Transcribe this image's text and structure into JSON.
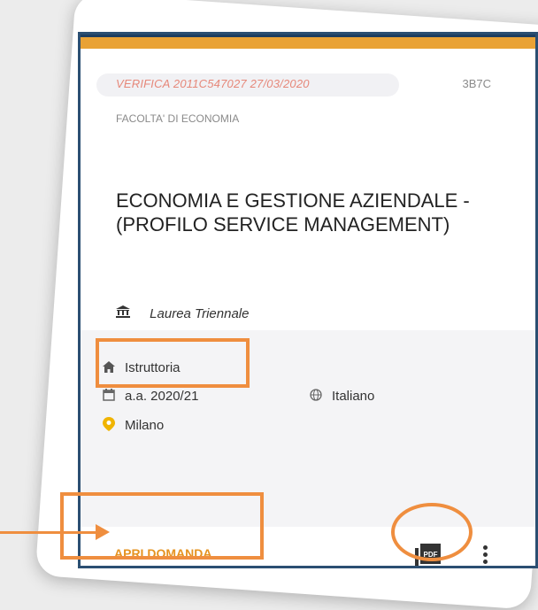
{
  "card": {
    "verifica": "VERIFICA  2011C547027  27/03/2020",
    "code": "3B7C",
    "faculty": "FACOLTA' DI ECONOMIA",
    "title": "ECONOMIA E GESTIONE AZIENDALE - (PROFILO SERVICE MANAGEMENT)",
    "degree_type": "Laurea  Triennale",
    "status": "Istruttoria",
    "academic_year": "a.a.  2020/21",
    "language": "Italiano",
    "location": "Milano",
    "open_button": "APRI DOMANDA",
    "pdf_label": "PDF"
  },
  "icons": {
    "degree": "institution-icon",
    "status": "home-icon",
    "year": "calendar-icon",
    "language": "globe-icon",
    "location": "location-pin-icon",
    "pdf": "pdf-icon",
    "more": "more-vert-icon"
  },
  "colors": {
    "accent": "#e69320",
    "highlight": "#ef8e3f",
    "header_bar": "#e9a235",
    "border": "#2b4f72",
    "verifica_text": "#e6887a"
  }
}
